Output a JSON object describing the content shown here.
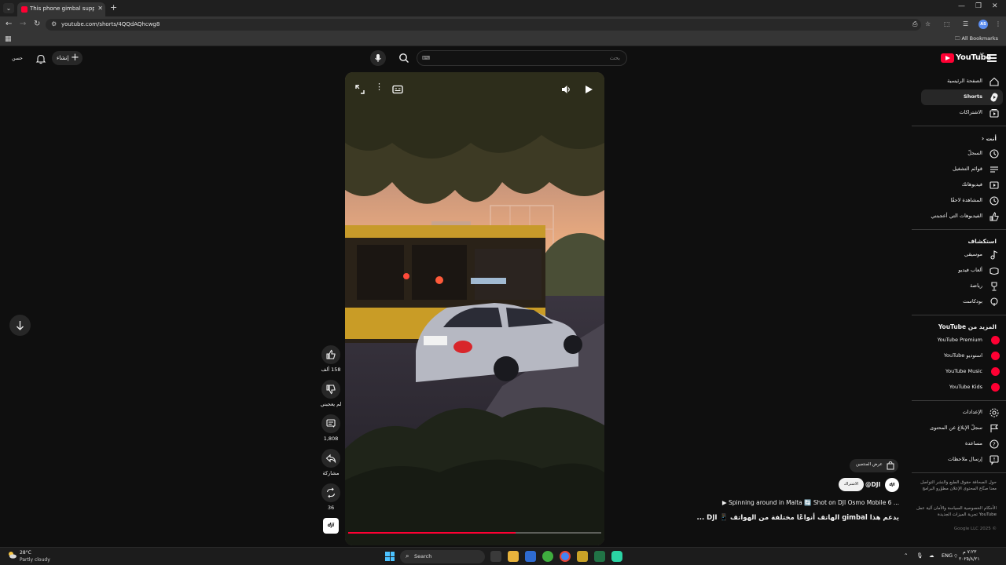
{
  "browser": {
    "tab_title": "This phone gimbal supports d",
    "url": "youtube.com/shorts/4QQdAQhcwg8",
    "all_bookmarks": "All Bookmarks",
    "profile_initials": "AS"
  },
  "masthead": {
    "logo_text": "YouTube",
    "country_code": "AE",
    "search_placeholder": "بحث",
    "search_kbd": "⌨",
    "create_label": "إنشاء",
    "avatar_label": "حسن"
  },
  "sidebar": {
    "main": [
      {
        "label": "الصفحة الرئيسية",
        "icon": "home-icon"
      },
      {
        "label": "Shorts",
        "icon": "shorts-icon",
        "active": true
      },
      {
        "label": "الاشتراكات",
        "icon": "subscriptions-icon"
      }
    ],
    "you_heading": "أنت",
    "you": [
      {
        "label": "السجلّ",
        "icon": "history-icon"
      },
      {
        "label": "قوائم التشغيل",
        "icon": "playlist-icon"
      },
      {
        "label": "فيديوهاتك",
        "icon": "your-videos-icon"
      },
      {
        "label": "المشاهدة لاحقًا",
        "icon": "watch-later-icon"
      },
      {
        "label": "الفيديوهات التي أعجبتني",
        "icon": "liked-icon"
      }
    ],
    "explore_heading": "استكشاف",
    "explore": [
      {
        "label": "موسيقى",
        "icon": "music-icon"
      },
      {
        "label": "ألعاب فيديو",
        "icon": "gaming-icon"
      },
      {
        "label": "رياضة",
        "icon": "trophy-icon"
      },
      {
        "label": "بودكاست",
        "icon": "podcast-icon"
      }
    ],
    "more_heading": "المزيد من YouTube",
    "more": [
      {
        "label": "YouTube Premium"
      },
      {
        "label": "استوديو YouTube"
      },
      {
        "label": "YouTube Music"
      },
      {
        "label": "YouTube Kids"
      }
    ],
    "settings": [
      {
        "label": "الإعدادات",
        "icon": "gear-icon"
      },
      {
        "label": "سجلّ الإبلاغ عن المحتوى",
        "icon": "flag-icon"
      },
      {
        "label": "مساعدة",
        "icon": "help-icon"
      },
      {
        "label": "إرسال ملاحظات",
        "icon": "feedback-icon"
      }
    ],
    "footer_1": "حول  الصحافة  حقوق الطبع والنشر  التواصل معنا  صنّاع المحتوى  الإعلان  مطوّرو البرامج",
    "footer_2": "الأحكام  الخصوصية  السياسة والأمان  آلية عمل YouTube  تجربة الميزات الجديدة",
    "copyright": "© 2025 Google LLC"
  },
  "player": {
    "progress": 0.66
  },
  "actions": {
    "likes": "158 ألف",
    "dislike": "لم يعجبني",
    "comments": "1,808",
    "share": "مشاركة",
    "remix": "36",
    "dji_thumb": "dji"
  },
  "video": {
    "products_label": "عرض المنتجين",
    "channel": "@DJI",
    "channel_avatar": "dji",
    "subscribe": "الاشتراك",
    "description": "▶ Spinning around in Malta 🔄 Shot on DJI Osmo Mobile 6 ...",
    "title": "يدعم هذا gimbal الهاتف أنواعًا مختلفة من الهواتف 📱 DJI ..."
  },
  "taskbar": {
    "temp": "28°C",
    "weather": "Partly cloudy",
    "search_label": "Search",
    "lang": "ENG",
    "time": "٧:٢٣ م",
    "date": "٢٠٢٥/٨/٢١"
  },
  "colors": {
    "accent": "#ff0033",
    "background": "#0f0f0f"
  }
}
